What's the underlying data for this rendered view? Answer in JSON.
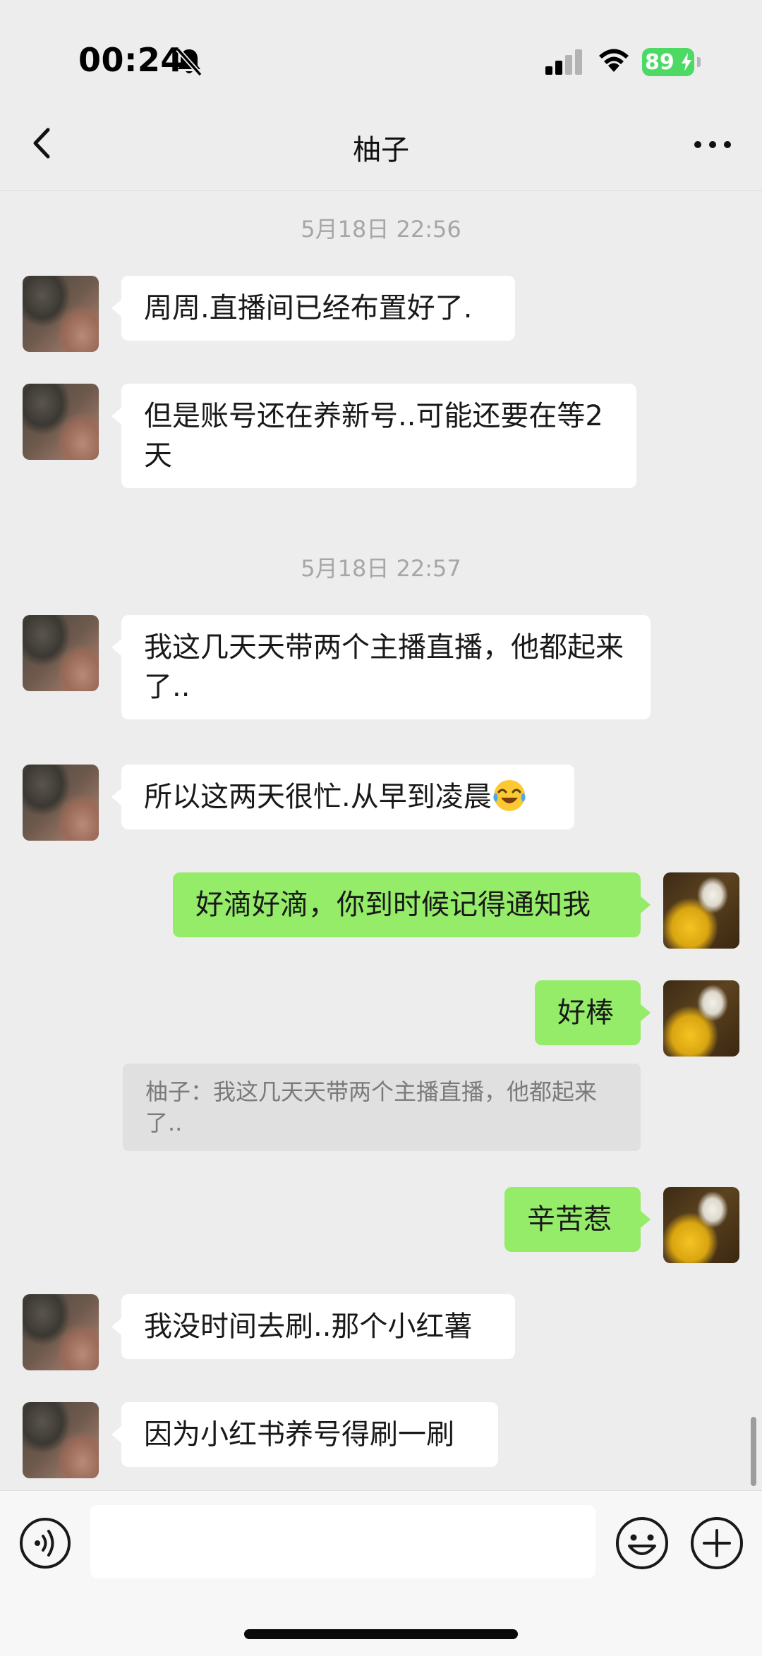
{
  "status_bar": {
    "time": "00:24",
    "battery": "89",
    "icons": [
      "bell-slash-icon",
      "signal-icon",
      "wifi-icon",
      "battery-icon"
    ]
  },
  "nav": {
    "title": "柚子",
    "back_icon": "chevron-left-icon",
    "more_icon": "more-horizontal-icon"
  },
  "chat": {
    "timestamps": [
      "5月18日 22:56",
      "5月18日 22:57"
    ],
    "messages": [
      {
        "from": "contact",
        "text": "周周.直播间已经布置好了."
      },
      {
        "from": "contact",
        "text": "但是账号还在养新号..可能还要在等2天"
      },
      {
        "from": "contact",
        "text": "我这几天天带两个主播直播，他都起来了.."
      },
      {
        "from": "contact",
        "text": "所以这两天很忙.从早到凌晨",
        "emoji": "laughing-crying-emoji"
      },
      {
        "from": "me",
        "text": "好滴好滴，你到时候记得通知我"
      },
      {
        "from": "me",
        "text": "好棒",
        "quote": "柚子：我这几天天带两个主播直播，他都起来了.."
      },
      {
        "from": "me",
        "text": "辛苦惹"
      },
      {
        "from": "contact",
        "text": "我没时间去刷..那个小红薯"
      },
      {
        "from": "contact",
        "text": "因为小红书养号得刷一刷"
      }
    ]
  },
  "input_bar": {
    "value": "",
    "icons": [
      "voice-icon",
      "emoji-icon",
      "plus-icon"
    ]
  },
  "colors": {
    "background": "#ededed",
    "incoming_bubble": "#ffffff",
    "outgoing_bubble": "#95ec69",
    "battery": "#4cd964"
  }
}
